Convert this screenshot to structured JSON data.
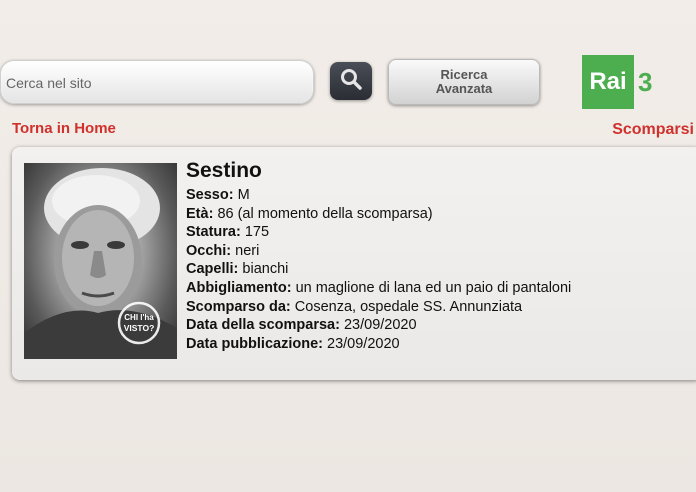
{
  "search": {
    "placeholder": "Cerca nel sito"
  },
  "advanced_search": {
    "line1": "Ricerca",
    "line2": "Avanzata"
  },
  "logo": {
    "text": "Rai",
    "number": "3",
    "color": "#4cae4f"
  },
  "nav": {
    "home": "Torna in Home",
    "section": "Scomparsi"
  },
  "accent_color": "#d0312d",
  "person": {
    "name": "Sestino",
    "photo_watermark": "CHI l'ha VISTO?",
    "fields": [
      {
        "label": "Sesso:",
        "value": "M"
      },
      {
        "label": "Età:",
        "value": "86 (al momento della scomparsa)"
      },
      {
        "label": "Statura:",
        "value": "175"
      },
      {
        "label": "Occhi:",
        "value": "neri"
      },
      {
        "label": "Capelli:",
        "value": "bianchi"
      },
      {
        "label": "Abbigliamento:",
        "value": "un maglione di lana ed un paio di pantaloni"
      },
      {
        "label": "Scomparso da:",
        "value": "Cosenza, ospedale SS. Annunziata"
      },
      {
        "label": "Data della scomparsa:",
        "value": "23/09/2020"
      },
      {
        "label": "Data pubblicazione:",
        "value": "23/09/2020"
      }
    ]
  }
}
